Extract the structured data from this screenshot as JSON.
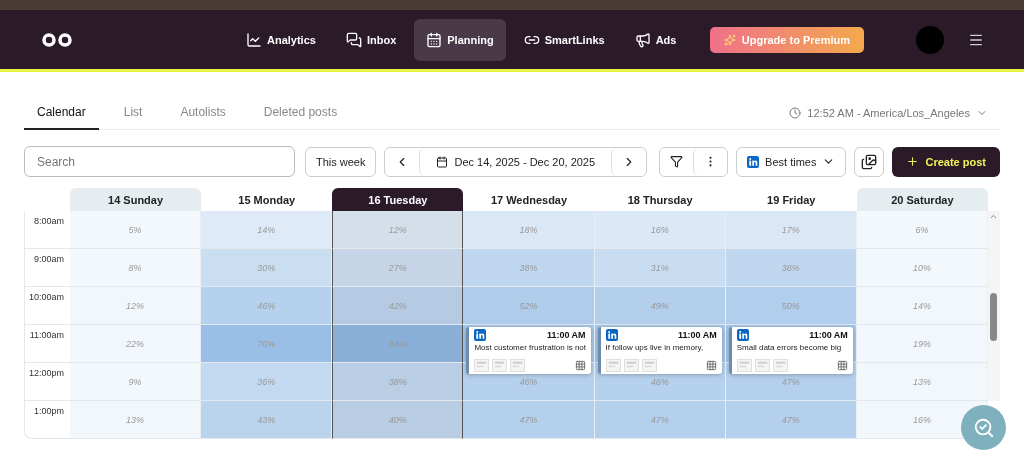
{
  "nav": {
    "items": [
      {
        "label": "Analytics",
        "selected": false
      },
      {
        "label": "Inbox",
        "selected": false
      },
      {
        "label": "Planning",
        "selected": true
      },
      {
        "label": "SmartLinks",
        "selected": false
      },
      {
        "label": "Ads",
        "selected": false
      }
    ],
    "upgrade": "Upgrade to Premium"
  },
  "tabs": [
    {
      "label": "Calendar",
      "selected": true
    },
    {
      "label": "List",
      "selected": false
    },
    {
      "label": "Autolists",
      "selected": false
    },
    {
      "label": "Deleted posts",
      "selected": false
    }
  ],
  "timezone": "12:52 AM - America/Los_Angeles",
  "toolbar": {
    "search": {
      "placeholder": "Search"
    },
    "this_week": "This week",
    "date_range": "Dec 14, 2025 - Dec 20, 2025",
    "best_times": "Best times",
    "create_post": "Create post"
  },
  "days": [
    {
      "label": "14 Sunday",
      "selected": false,
      "weekend": true
    },
    {
      "label": "15 Monday",
      "selected": false,
      "weekend": false
    },
    {
      "label": "16 Tuesday",
      "selected": true,
      "weekend": false
    },
    {
      "label": "17 Wednesday",
      "selected": false,
      "weekend": false
    },
    {
      "label": "18 Thursday",
      "selected": false,
      "weekend": false
    },
    {
      "label": "19 Friday",
      "selected": false,
      "weekend": false
    },
    {
      "label": "20 Saturday",
      "selected": false,
      "weekend": true
    }
  ],
  "rows": [
    {
      "time": "8:00am",
      "cells": [
        {
          "value": "5%"
        },
        {
          "value": "14%"
        },
        {
          "value": "12%"
        },
        {
          "value": "18%"
        },
        {
          "value": "16%"
        },
        {
          "value": "17%"
        },
        {
          "value": "6%"
        }
      ]
    },
    {
      "time": "9:00am",
      "cells": [
        {
          "value": "8%"
        },
        {
          "value": "30%"
        },
        {
          "value": "27%"
        },
        {
          "value": "38%"
        },
        {
          "value": "31%"
        },
        {
          "value": "38%"
        },
        {
          "value": "10%"
        }
      ]
    },
    {
      "time": "10:00am",
      "cells": [
        {
          "value": "12%"
        },
        {
          "value": "46%"
        },
        {
          "value": "42%"
        },
        {
          "value": "52%"
        },
        {
          "value": "49%"
        },
        {
          "value": "50%"
        },
        {
          "value": "14%"
        }
      ]
    },
    {
      "time": "11:00am",
      "cells": [
        {
          "value": "22%"
        },
        {
          "value": "70%"
        },
        {
          "value": "84%"
        },
        {
          "post": {
            "time": "11:00 AM",
            "text": "Most customer frustration is not"
          }
        },
        {
          "post": {
            "time": "11:00 AM",
            "text": "If follow ups live in memory,"
          }
        },
        {
          "post": {
            "time": "11:00 AM",
            "text": "Small data errors become big"
          }
        },
        {
          "value": "19%"
        }
      ]
    },
    {
      "time": "12:00pm",
      "cells": [
        {
          "value": "9%"
        },
        {
          "value": "36%"
        },
        {
          "value": "38%"
        },
        {
          "value": "46%"
        },
        {
          "value": "46%"
        },
        {
          "value": "47%"
        },
        {
          "value": "13%"
        }
      ]
    },
    {
      "time": "1:00pm",
      "cells": [
        {
          "value": "13%"
        },
        {
          "value": "43%"
        },
        {
          "value": "40%"
        },
        {
          "value": "47%"
        },
        {
          "value": "47%"
        },
        {
          "value": "47%"
        },
        {
          "value": "16%"
        }
      ]
    }
  ]
}
